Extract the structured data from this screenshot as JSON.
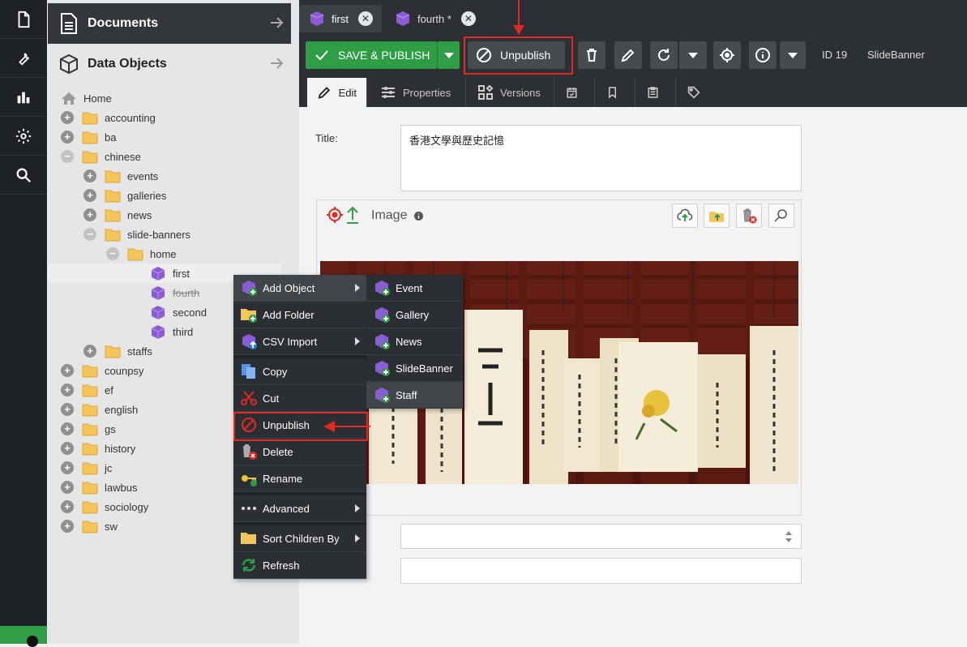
{
  "sidebar_panels": {
    "documents": "Documents",
    "data_objects": "Data Objects"
  },
  "tree": {
    "home": "Home",
    "nodes": [
      "accounting",
      "ba",
      "chinese",
      "events",
      "galleries",
      "news",
      "slide-banners",
      "home",
      "first",
      "fourth",
      "second",
      "third",
      "staffs",
      "counpsy",
      "ef",
      "english",
      "gs",
      "history",
      "jc",
      "lawbus",
      "sociology",
      "sw"
    ]
  },
  "tabs": [
    {
      "label": "first"
    },
    {
      "label": "fourth *"
    }
  ],
  "toolbar": {
    "save_publish": "SAVE & PUBLISH",
    "unpublish": "Unpublish",
    "id_label": "ID 19",
    "class_label": "SlideBanner"
  },
  "subtabs": [
    "Edit",
    "Properties",
    "Versions"
  ],
  "form": {
    "title_label": "Title:",
    "title_value": "香港文學與歷史記憶",
    "image_label": "Image"
  },
  "context_menu": {
    "items": [
      "Add Object",
      "Add Folder",
      "CSV Import",
      "Copy",
      "Cut",
      "Unpublish",
      "Delete",
      "Rename",
      "Advanced",
      "Sort Children By",
      "Refresh"
    ]
  },
  "submenu": {
    "items": [
      "Event",
      "Gallery",
      "News",
      "SlideBanner",
      "Staff"
    ]
  },
  "colors": {
    "accent_green": "#2f9d45",
    "annotation_red": "#e12a21",
    "dark_bg": "#2c3034",
    "folder_yellow": "#f5c65a",
    "object_purple": "#8c5bd6"
  }
}
